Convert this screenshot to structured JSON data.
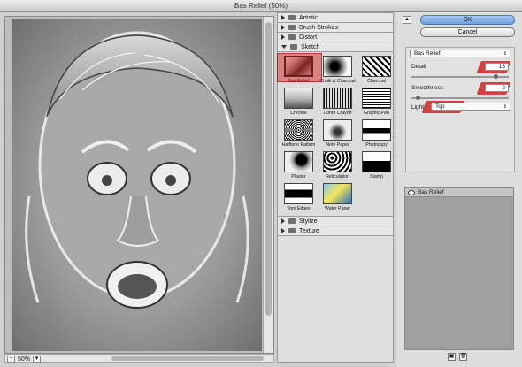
{
  "window": {
    "title": "Bas Relief (50%)"
  },
  "preview": {
    "zoom": "50%"
  },
  "gallery": {
    "categories_before": [
      {
        "label": "Artistic"
      },
      {
        "label": "Brush Strokes"
      },
      {
        "label": "Distort"
      }
    ],
    "open_category": {
      "label": "Sketch"
    },
    "filters": [
      {
        "label": "Bas Relief",
        "icon": "bas-relief-thumb"
      },
      {
        "label": "Chalk & Charcoal",
        "icon": "chalk-charcoal-thumb"
      },
      {
        "label": "Charcoal",
        "icon": "charcoal-thumb"
      },
      {
        "label": "Chrome",
        "icon": "chrome-thumb"
      },
      {
        "label": "Conté Crayon",
        "icon": "conte-crayon-thumb"
      },
      {
        "label": "Graphic Pen",
        "icon": "graphic-pen-thumb"
      },
      {
        "label": "Halftone Pattern",
        "icon": "halftone-thumb"
      },
      {
        "label": "Note Paper",
        "icon": "note-paper-thumb"
      },
      {
        "label": "Photocopy",
        "icon": "photocopy-thumb"
      },
      {
        "label": "Plaster",
        "icon": "plaster-thumb"
      },
      {
        "label": "Reticulation",
        "icon": "reticulation-thumb"
      },
      {
        "label": "Stamp",
        "icon": "stamp-thumb"
      },
      {
        "label": "Torn Edges",
        "icon": "torn-edges-thumb"
      },
      {
        "label": "Water Paper",
        "icon": "water-paper-thumb"
      }
    ],
    "selected_filter": "Bas Relief",
    "categories_after": [
      {
        "label": "Stylize"
      },
      {
        "label": "Texture"
      }
    ]
  },
  "buttons": {
    "ok": "OK",
    "cancel": "Cancel"
  },
  "settings": {
    "filter_select": "Bas Relief",
    "detail_label": "Detail",
    "detail_value": "13",
    "detail_level": 0.87,
    "smoothness_label": "Smoothness",
    "smoothness_value": "2",
    "smoothness_level": 0.07,
    "light_label": "Light:",
    "light_value": "Top"
  },
  "layers": {
    "items": [
      {
        "label": "Bas Relief"
      }
    ]
  },
  "colors": {
    "highlight": "#d21414",
    "ok_button": "#6f9fdf"
  }
}
